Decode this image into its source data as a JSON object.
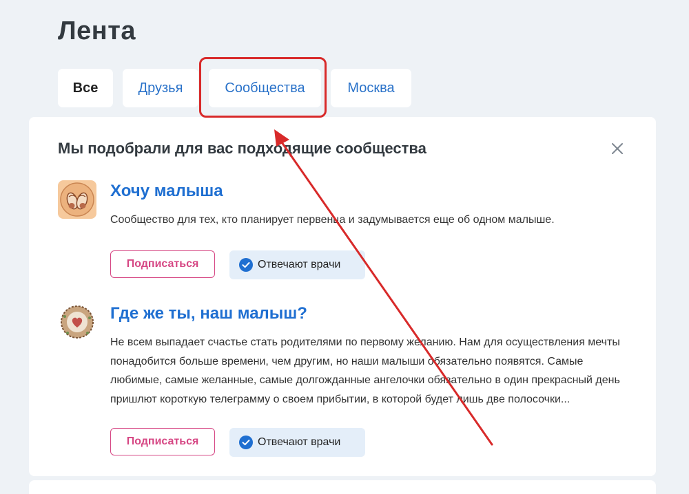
{
  "page": {
    "title": "Лента"
  },
  "tabs": [
    {
      "label": "Все",
      "active": true
    },
    {
      "label": "Друзья",
      "active": false
    },
    {
      "label": "Сообщества",
      "active": false
    },
    {
      "label": "Москва",
      "active": false
    }
  ],
  "recommendations": {
    "title": "Мы подобрали для вас подходящие сообщества",
    "close_icon": "close-icon",
    "communities": [
      {
        "name": "Хочу малыша",
        "description": "Сообщество для тех, кто планирует первенца и задумывается еще об одном малыше.",
        "subscribe_label": "Подписаться",
        "badge_label": "Отвечают врачи",
        "avatar_icon": "baby-shoes-icon"
      },
      {
        "name": "Где же ты, наш малыш?",
        "description": "Не всем выпадает счастье стать родителями по первому желанию. Нам для осуществления мечты понадобится больше времени, чем другим, но наши малыши обязательно появятся. Самые любимые, самые желанные, самые долгожданные ангелочки обязательно в один прекрасный день пришлют короткую телеграмму о своем прибытии, в которой будет лишь две полосочки...",
        "subscribe_label": "Подписаться",
        "badge_label": "Отвечают врачи",
        "avatar_icon": "heart-nest-icon"
      }
    ]
  },
  "colors": {
    "background": "#eef2f6",
    "link_blue": "#1f6fd1",
    "subscribe_pink": "#d64784",
    "badge_bg": "#e4eef9",
    "annotation_red": "#d82a2a"
  }
}
